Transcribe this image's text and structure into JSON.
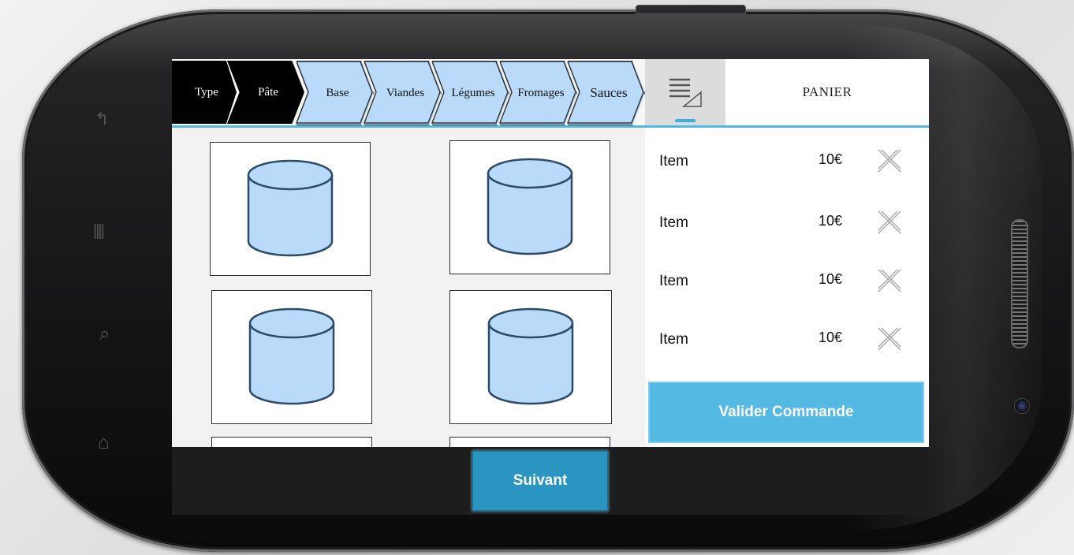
{
  "breadcrumb": [
    {
      "label": "Type",
      "state": "done"
    },
    {
      "label": "Pâte",
      "state": "done"
    },
    {
      "label": "Base",
      "state": "todo"
    },
    {
      "label": "Viandes",
      "state": "todo"
    },
    {
      "label": "Légumes",
      "state": "todo"
    },
    {
      "label": "Fromages",
      "state": "todo"
    },
    {
      "label": "Sauces",
      "state": "todo"
    }
  ],
  "tabs": {
    "list_icon": "list-resize-icon",
    "panier_label": "PANIER"
  },
  "product_grid": {
    "tile_icon": "cylinder-placeholder-icon",
    "tile_count_visible": 6
  },
  "cart": {
    "items": [
      {
        "name": "Item",
        "price": "10€"
      },
      {
        "name": "Item",
        "price": "10€"
      },
      {
        "name": "Item",
        "price": "10€"
      },
      {
        "name": "Item",
        "price": "10€"
      }
    ],
    "remove_icon": "close-x-icon",
    "validate_label": "Valider Commande"
  },
  "footer": {
    "next_label": "Suivant"
  },
  "colors": {
    "accent": "#54b9e3",
    "next_button": "#2a95c0",
    "crumb_done": "#000000",
    "crumb_todo": "#b9daf8"
  }
}
